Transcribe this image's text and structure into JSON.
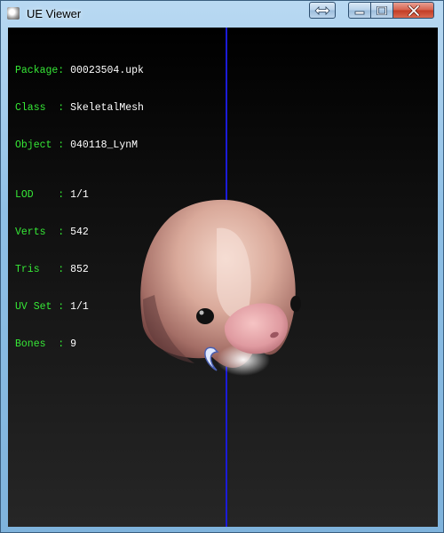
{
  "window": {
    "title": "UE Viewer",
    "icon": "app-icon"
  },
  "caption_buttons": {
    "restore_size": "swap-arrows-icon",
    "minimize": "minimize-icon",
    "maximize": "maximize-icon",
    "close": "close-icon"
  },
  "info": {
    "package": {
      "label": "Package:",
      "value": "00023504.upk"
    },
    "class": {
      "label": "Class  :",
      "value": "SkeletalMesh"
    },
    "object": {
      "label": "Object :",
      "value": "040118_LynM"
    },
    "lod": {
      "label": "LOD    :",
      "value": "1/1"
    },
    "verts": {
      "label": "Verts  :",
      "value": "542"
    },
    "tris": {
      "label": "Tris   :",
      "value": "852"
    },
    "uvset": {
      "label": "UV Set :",
      "value": "1/1"
    },
    "bones": {
      "label": "Bones  :",
      "value": "9"
    }
  },
  "colors": {
    "label_green": "#36e836",
    "axis_blue": "#1b1bd8"
  }
}
